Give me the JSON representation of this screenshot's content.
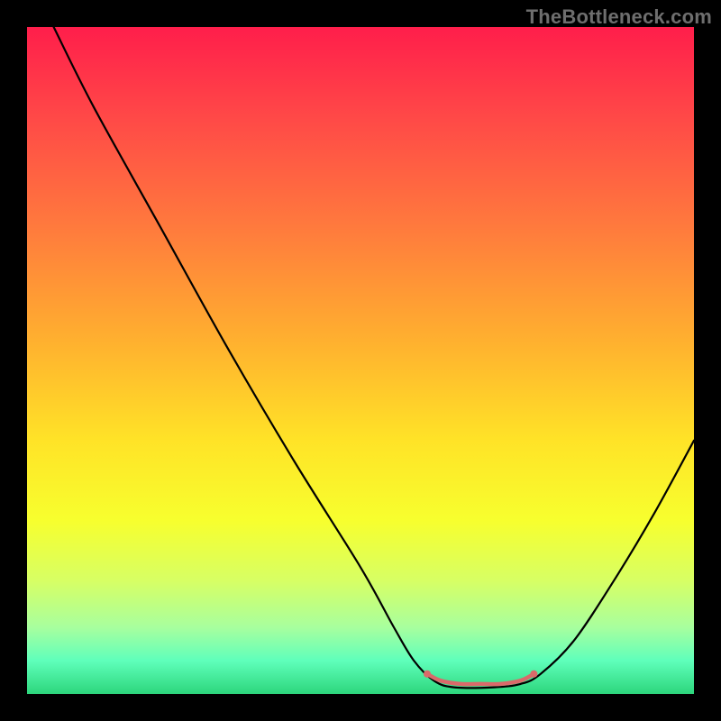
{
  "watermark": "TheBottleneck.com",
  "chart_data": {
    "type": "line",
    "title": "",
    "xlabel": "",
    "ylabel": "",
    "xlim": [
      0,
      100
    ],
    "ylim": [
      0,
      100
    ],
    "grid": false,
    "legend": false,
    "background_gradient_stops": [
      {
        "pct": 0,
        "color": "#ff1e4b"
      },
      {
        "pct": 14,
        "color": "#ff4a47"
      },
      {
        "pct": 30,
        "color": "#ff7a3d"
      },
      {
        "pct": 47,
        "color": "#ffb02f"
      },
      {
        "pct": 62,
        "color": "#ffe327"
      },
      {
        "pct": 74,
        "color": "#f7ff2e"
      },
      {
        "pct": 83,
        "color": "#d7ff64"
      },
      {
        "pct": 90,
        "color": "#a8ff9e"
      },
      {
        "pct": 95,
        "color": "#5fffbb"
      },
      {
        "pct": 100,
        "color": "#2dd67c"
      }
    ],
    "series": [
      {
        "name": "curve",
        "color": "#000000",
        "width": 2.2,
        "points": [
          {
            "x": 4,
            "y": 100
          },
          {
            "x": 10,
            "y": 88
          },
          {
            "x": 20,
            "y": 70
          },
          {
            "x": 30,
            "y": 52
          },
          {
            "x": 40,
            "y": 35
          },
          {
            "x": 50,
            "y": 19
          },
          {
            "x": 55,
            "y": 10
          },
          {
            "x": 58,
            "y": 5
          },
          {
            "x": 61,
            "y": 2
          },
          {
            "x": 64,
            "y": 1
          },
          {
            "x": 70,
            "y": 1
          },
          {
            "x": 74,
            "y": 1.5
          },
          {
            "x": 77,
            "y": 3
          },
          {
            "x": 82,
            "y": 8
          },
          {
            "x": 88,
            "y": 17
          },
          {
            "x": 94,
            "y": 27
          },
          {
            "x": 100,
            "y": 38
          }
        ]
      },
      {
        "name": "valley-marker",
        "color": "#d96a6a",
        "width": 4.5,
        "points": [
          {
            "x": 60,
            "y": 3
          },
          {
            "x": 62,
            "y": 2
          },
          {
            "x": 65,
            "y": 1.5
          },
          {
            "x": 68,
            "y": 1.5
          },
          {
            "x": 71,
            "y": 1.5
          },
          {
            "x": 74,
            "y": 2
          },
          {
            "x": 76,
            "y": 3
          }
        ],
        "dots": [
          {
            "x": 60,
            "y": 3
          },
          {
            "x": 76,
            "y": 3
          }
        ]
      }
    ]
  }
}
